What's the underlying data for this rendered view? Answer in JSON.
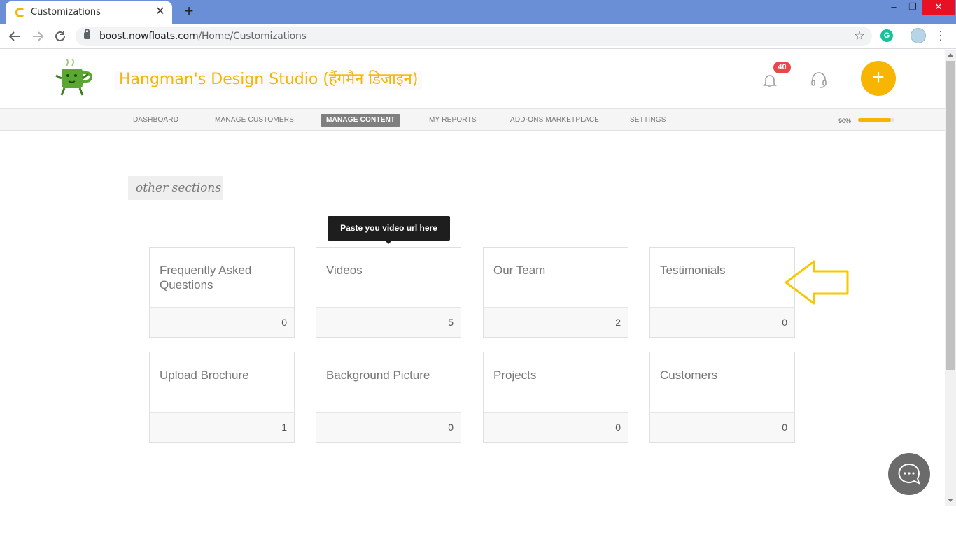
{
  "browser": {
    "tab_title": "Customizations",
    "tab_close": "✕",
    "new_tab": "+",
    "url_host": "boost.nowfloats.com",
    "url_path": "/Home/Customizations",
    "window_controls": {
      "minimize": "–",
      "maximize": "❐",
      "close": "✕"
    },
    "extension_letter": "G"
  },
  "header": {
    "business_name": "Hangman's Design Studio (हैंगमैन डिजाइन)",
    "notification_count": "40",
    "add_label": "+"
  },
  "nav": {
    "items": [
      {
        "label": "DASHBOARD",
        "active": false
      },
      {
        "label": "MANAGE CUSTOMERS",
        "active": false
      },
      {
        "label": "MANAGE CONTENT",
        "active": true
      },
      {
        "label": "MY REPORTS",
        "active": false
      },
      {
        "label": "ADD-ONS MARKETPLACE",
        "active": false
      },
      {
        "label": "SETTINGS",
        "active": false
      }
    ],
    "progress_label": "90%",
    "progress_value": 0.9
  },
  "main": {
    "section_title": "other sections",
    "tooltip": "Paste you video url here",
    "cards": [
      {
        "title": "Frequently Asked Questions",
        "count": "0"
      },
      {
        "title": "Videos",
        "count": "5"
      },
      {
        "title": "Our Team",
        "count": "2"
      },
      {
        "title": "Testimonials",
        "count": "0"
      },
      {
        "title": "Upload Brochure",
        "count": "1"
      },
      {
        "title": "Background Picture",
        "count": "0"
      },
      {
        "title": "Projects",
        "count": "0"
      },
      {
        "title": "Customers",
        "count": "0"
      }
    ]
  },
  "colors": {
    "brand": "#f7b500",
    "badge": "#e8474b",
    "chrome_titlebar": "#6a8fd6",
    "chat_fab": "#6b6b6b"
  },
  "icons": {
    "bell": "bell-icon",
    "headset": "headset-icon",
    "chat": "chat-icon",
    "annotation_arrow": "left-arrow-icon"
  }
}
